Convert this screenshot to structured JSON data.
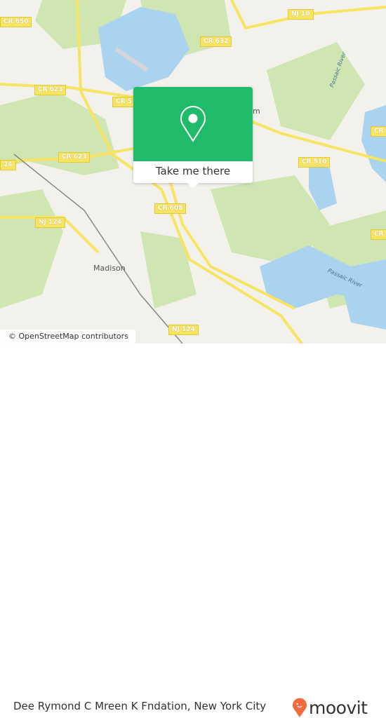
{
  "map": {
    "shields": [
      {
        "label": "CR 650"
      },
      {
        "label": "NJ 10"
      },
      {
        "label": "CR 632"
      },
      {
        "label": "CR 623"
      },
      {
        "label": "CR 5"
      },
      {
        "label": "CR 623"
      },
      {
        "label": "24"
      },
      {
        "label": "CR 510"
      },
      {
        "label": "CR 608"
      },
      {
        "label": "NJ 124"
      },
      {
        "label": "NJ 124"
      },
      {
        "label": "CR"
      },
      {
        "label": "CR"
      }
    ],
    "places": [
      {
        "label": "Madison"
      },
      {
        "label": "m"
      }
    ],
    "rivers": [
      {
        "label": "Passaic River"
      },
      {
        "label": "Passaic River"
      }
    ],
    "attribution": "© OpenStreetMap contributors",
    "colors": {
      "water": "#a9d3ee",
      "park": "#cfe6b3",
      "road": "#f7e463",
      "background": "#f2f1ec"
    }
  },
  "popup": {
    "button_label": "Take me there",
    "icon": "location-pin-icon",
    "color": "#1fba6a"
  },
  "footer": {
    "title": "Dee Rymond C Mreen K Fndation, New York City",
    "logo_text": "moovit",
    "logo_color": "#f26a3d"
  }
}
